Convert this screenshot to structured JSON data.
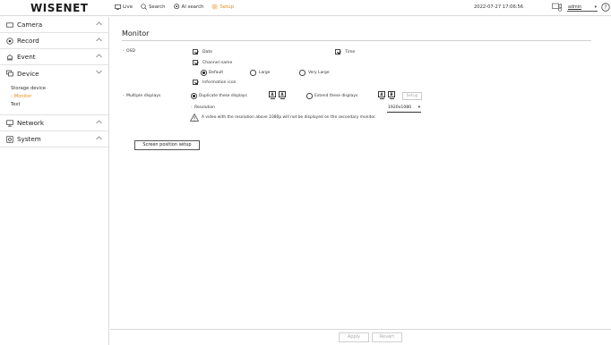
{
  "header": {
    "logo": "WISENET",
    "nav": [
      {
        "label": "Live",
        "icon": "monitor-icon"
      },
      {
        "label": "Search",
        "icon": "search-icon"
      },
      {
        "label": "AI search",
        "icon": "ai-search-icon"
      },
      {
        "label": "Setup",
        "icon": "gear-icon"
      }
    ],
    "datetime": "2022-07-27 17:06:56",
    "user": "admin",
    "accent_color": "#e88a1a"
  },
  "sidebar": {
    "menus": [
      {
        "label": "Camera",
        "icon": "camera-icon"
      },
      {
        "label": "Record",
        "icon": "record-icon"
      },
      {
        "label": "Event",
        "icon": "bell-icon"
      },
      {
        "label": "Device",
        "icon": "device-icon",
        "expanded": true,
        "sub": [
          "Storage device",
          "Monitor",
          "Text"
        ],
        "active_sub": "Monitor"
      },
      {
        "label": "Network",
        "icon": "network-icon"
      },
      {
        "label": "System",
        "icon": "system-icon"
      }
    ]
  },
  "main": {
    "title": "Monitor",
    "osd": {
      "label": "OSD",
      "date": "Date",
      "time": "Time",
      "channel_name": "Channel name",
      "sizes": [
        "Default",
        "Large",
        "Very Large"
      ],
      "selected_size": "Default",
      "information_icon": "Information icon"
    },
    "multiple_displays": {
      "label": "Multiple displays",
      "duplicate": "Duplicate these displays",
      "extend": "Extend these displays",
      "selected": "Duplicate these displays",
      "setup": "Setup",
      "resolution_label": "Resolution",
      "resolution_value": "1920x1080",
      "warning": "A video with the resolution above 1080p will not be displayed on the secondary monitor."
    },
    "screen_position_button": "Screen position setup",
    "apply": "Apply",
    "revert": "Revert"
  }
}
